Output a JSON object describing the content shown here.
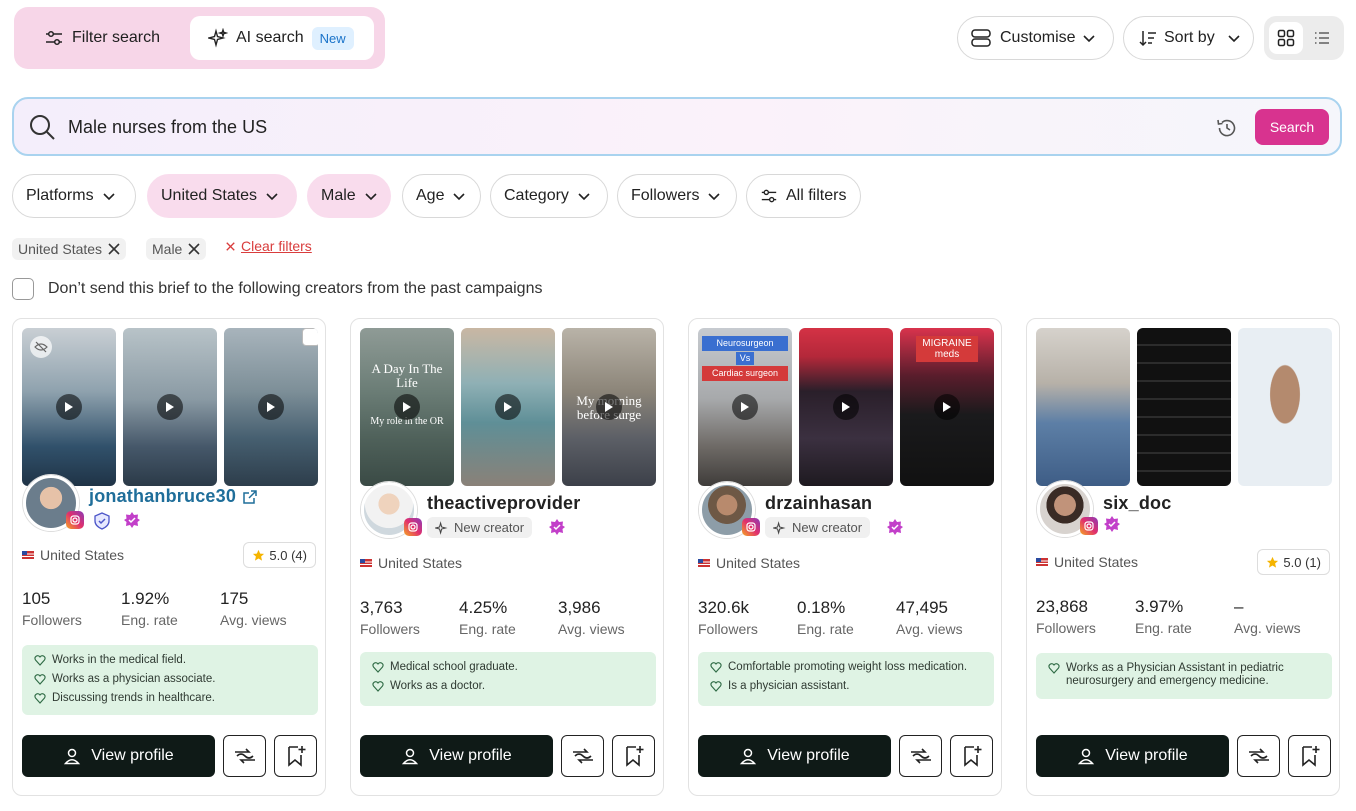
{
  "toolbar": {
    "filter_search": "Filter search",
    "ai_search": "AI search",
    "new_badge": "New",
    "customise": "Customise",
    "sort_by": "Sort by"
  },
  "search": {
    "query": "Male nurses from the US",
    "button": "Search"
  },
  "filters": {
    "platforms": "Platforms",
    "country": "United States",
    "gender": "Male",
    "age": "Age",
    "category": "Category",
    "followers": "Followers",
    "all_filters": "All filters"
  },
  "active_chips": [
    "United States",
    "Male"
  ],
  "clear_filters": "Clear filters",
  "exclude_label": "Don’t send this brief to the following creators from the past campaigns",
  "stat_labels": {
    "followers": "Followers",
    "eng": "Eng. rate",
    "views": "Avg. views"
  },
  "view_profile": "View profile",
  "creators": [
    {
      "username": "jonathanbruce30",
      "location": "United States",
      "rating": "5.0 (4)",
      "followers": "105",
      "eng_rate": "1.92%",
      "avg_views": "175",
      "notes": [
        "Works in the medical field.",
        "Works as a physician associate.",
        "Discussing trends in healthcare."
      ]
    },
    {
      "username": "theactiveprovider",
      "tag": "New creator",
      "location": "United States",
      "followers": "3,763",
      "eng_rate": "4.25%",
      "avg_views": "3,986",
      "thumb_texts": [
        "A Day In The Life",
        "My role in the OR",
        "My morning before surge"
      ],
      "notes": [
        "Medical school graduate.",
        "Works as a doctor."
      ]
    },
    {
      "username": "drzainhasan",
      "tag": "New creator",
      "location": "United States",
      "followers": "320.6k",
      "eng_rate": "0.18%",
      "avg_views": "47,495",
      "thumb_texts": [
        "Neurosurgeon",
        "Vs",
        "Cardiac surgeon",
        "MIGRAINE meds"
      ],
      "notes": [
        "Comfortable promoting weight loss medication.",
        "Is a physician assistant."
      ]
    },
    {
      "username": "six_doc",
      "location": "United States",
      "rating": "5.0 (1)",
      "followers": "23,868",
      "eng_rate": "3.97%",
      "avg_views": "–",
      "notes": [
        "Works as a Physician Assistant in pediatric neurosurgery and emergency medicine."
      ]
    }
  ],
  "colors": {
    "accent": "#d8338f",
    "dark": "#0f1a17",
    "note_bg": "#dff3e4"
  }
}
